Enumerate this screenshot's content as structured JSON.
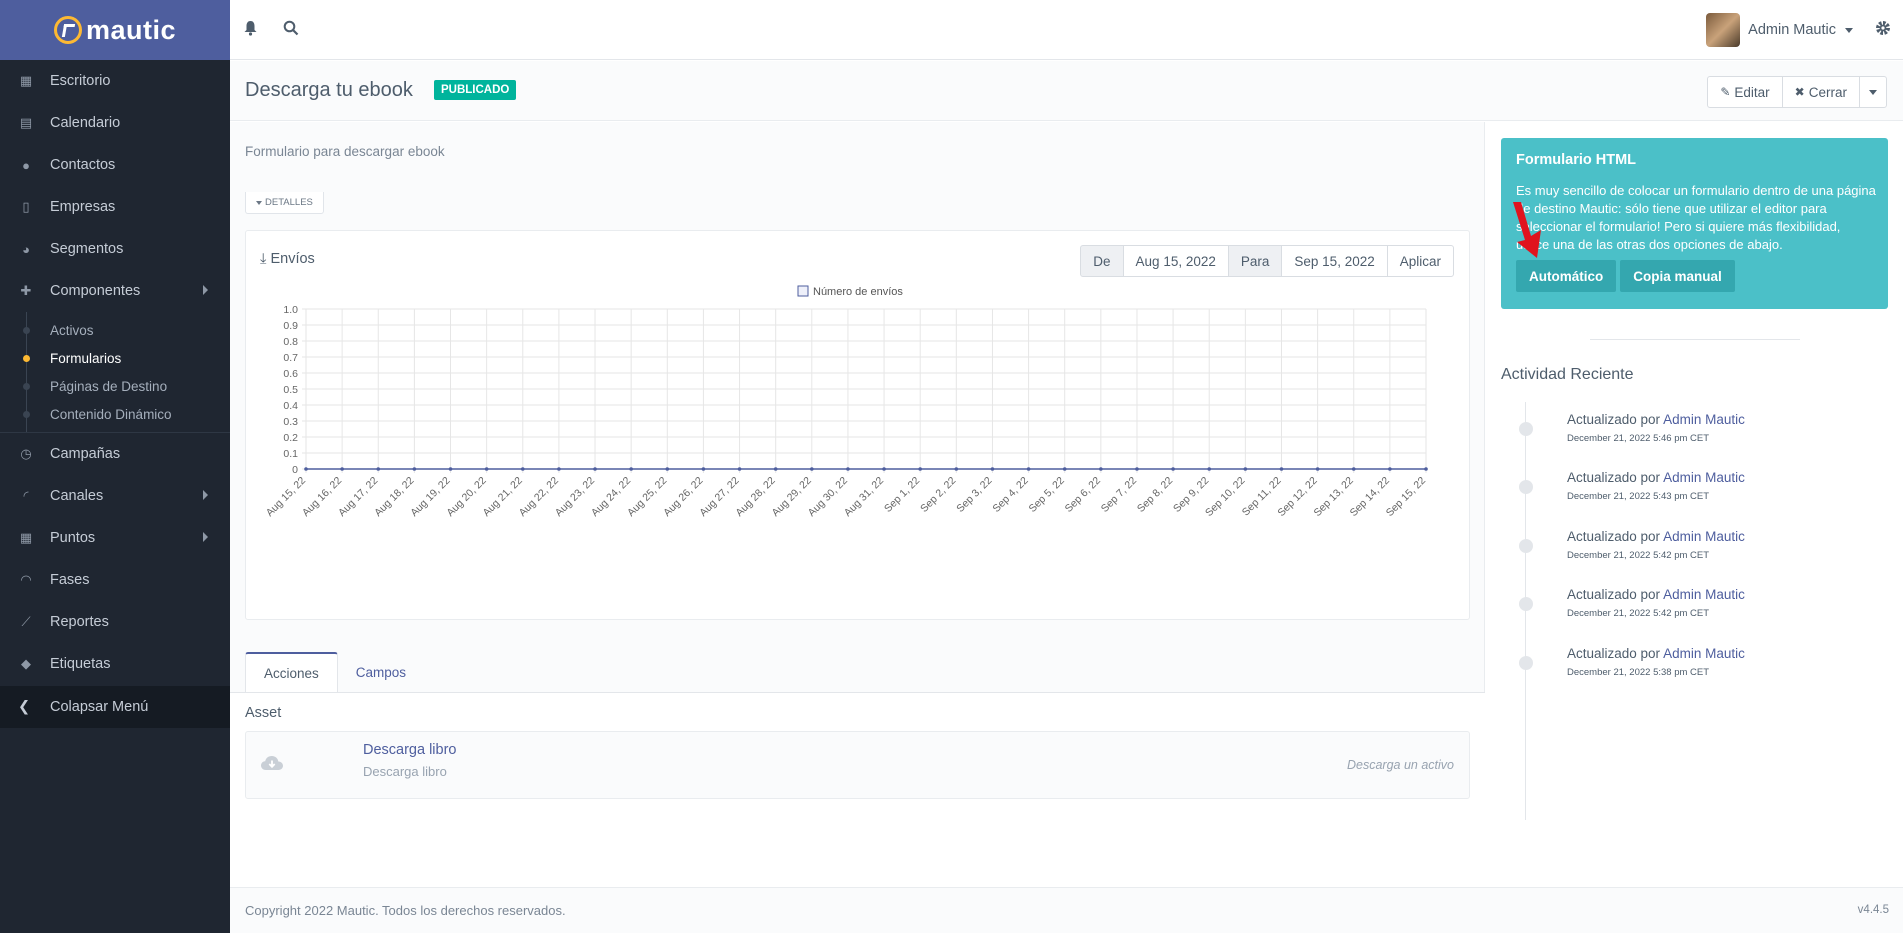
{
  "brand": {
    "name": "mautic"
  },
  "sidebar": {
    "items": [
      {
        "label": "Escritorio",
        "icon": "dashboard-icon"
      },
      {
        "label": "Calendario",
        "icon": "calendar-icon"
      },
      {
        "label": "Contactos",
        "icon": "user-icon"
      },
      {
        "label": "Empresas",
        "icon": "building-icon"
      },
      {
        "label": "Segmentos",
        "icon": "pie-chart-icon"
      },
      {
        "label": "Componentes",
        "icon": "puzzle-icon",
        "expanded": true
      }
    ],
    "sub_items": [
      {
        "label": "Activos",
        "active": false
      },
      {
        "label": "Formularios",
        "active": true
      },
      {
        "label": "Páginas de Destino",
        "active": false
      },
      {
        "label": "Contenido Dinámico",
        "active": false
      }
    ],
    "items_after": [
      {
        "label": "Campañas",
        "icon": "clock-icon"
      },
      {
        "label": "Canales",
        "icon": "rss-icon",
        "has_children": true
      },
      {
        "label": "Puntos",
        "icon": "calculator-icon",
        "has_children": true
      },
      {
        "label": "Fases",
        "icon": "gauge-icon"
      },
      {
        "label": "Reportes",
        "icon": "line-chart-icon"
      },
      {
        "label": "Etiquetas",
        "icon": "tag-icon"
      }
    ],
    "collapse_label": "Colapsar Menú"
  },
  "topbar": {
    "user_name": "Admin Mautic"
  },
  "header": {
    "title": "Descarga tu ebook",
    "status": "PUBLICADO",
    "edit_label": "Editar",
    "close_label": "Cerrar"
  },
  "main": {
    "description": "Formulario para descargar ebook",
    "details_label": "DETALLES",
    "chart_title": "Envíos",
    "date_filter": {
      "from_label": "De",
      "from_value": "Aug 15, 2022",
      "to_label": "Para",
      "to_value": "Sep 15, 2022",
      "apply_label": "Aplicar"
    },
    "tabs": [
      {
        "label": "Acciones",
        "active": true
      },
      {
        "label": "Campos",
        "active": false
      }
    ],
    "section_title": "Asset",
    "action": {
      "title": "Descarga libro",
      "subtitle": "Descarga libro",
      "type": "Descarga un activo"
    }
  },
  "chart_data": {
    "type": "line",
    "x": [
      "Aug 15, 22",
      "Aug 16, 22",
      "Aug 17, 22",
      "Aug 18, 22",
      "Aug 19, 22",
      "Aug 20, 22",
      "Aug 21, 22",
      "Aug 22, 22",
      "Aug 23, 22",
      "Aug 24, 22",
      "Aug 25, 22",
      "Aug 26, 22",
      "Aug 27, 22",
      "Aug 28, 22",
      "Aug 29, 22",
      "Aug 30, 22",
      "Aug 31, 22",
      "Sep 1, 22",
      "Sep 2, 22",
      "Sep 3, 22",
      "Sep 4, 22",
      "Sep 5, 22",
      "Sep 6, 22",
      "Sep 7, 22",
      "Sep 8, 22",
      "Sep 9, 22",
      "Sep 10, 22",
      "Sep 11, 22",
      "Sep 12, 22",
      "Sep 13, 22",
      "Sep 14, 22",
      "Sep 15, 22"
    ],
    "series": [
      {
        "name": "Número de envíos",
        "values": [
          0,
          0,
          0,
          0,
          0,
          0,
          0,
          0,
          0,
          0,
          0,
          0,
          0,
          0,
          0,
          0,
          0,
          0,
          0,
          0,
          0,
          0,
          0,
          0,
          0,
          0,
          0,
          0,
          0,
          0,
          0,
          0
        ]
      }
    ],
    "yticks": [
      "1.0",
      "0.9",
      "0.8",
      "0.7",
      "0.6",
      "0.5",
      "0.4",
      "0.3",
      "0.2",
      "0.1",
      "0"
    ],
    "ylim": [
      0,
      1
    ],
    "grid": true,
    "legend": "top-center",
    "color": "#4e5e9e"
  },
  "right": {
    "html_title": "Formulario HTML",
    "html_desc": "Es muy sencillo de colocar un formulario dentro de una página de destino Mautic: sólo tiene que utilizar el editor para seleccionar el formulario! Pero si quiere más flexibilidad, utilice una de las otras dos opciones de abajo.",
    "auto_label": "Automático",
    "manual_label": "Copia manual",
    "recent_title": "Actividad Reciente",
    "activities": [
      {
        "prefix": "Actualizado por",
        "user": "Admin Mautic",
        "date": "December 21, 2022 5:46 pm CET"
      },
      {
        "prefix": "Actualizado por",
        "user": "Admin Mautic",
        "date": "December 21, 2022 5:43 pm CET"
      },
      {
        "prefix": "Actualizado por",
        "user": "Admin Mautic",
        "date": "December 21, 2022 5:42 pm CET"
      },
      {
        "prefix": "Actualizado por",
        "user": "Admin Mautic",
        "date": "December 21, 2022 5:42 pm CET"
      },
      {
        "prefix": "Actualizado por",
        "user": "Admin Mautic",
        "date": "December 21, 2022 5:38 pm CET"
      }
    ]
  },
  "footer": {
    "copyright": "Copyright 2022 Mautic. Todos los derechos reservados.",
    "version": "v4.4.5"
  },
  "colors": {
    "accent": "#4e5e9e",
    "sidebar": "#1f2631",
    "badge": "#00b49c",
    "info_box": "#4bc0c8",
    "active_dot": "#fdb933",
    "arrow": "#e0141e"
  }
}
